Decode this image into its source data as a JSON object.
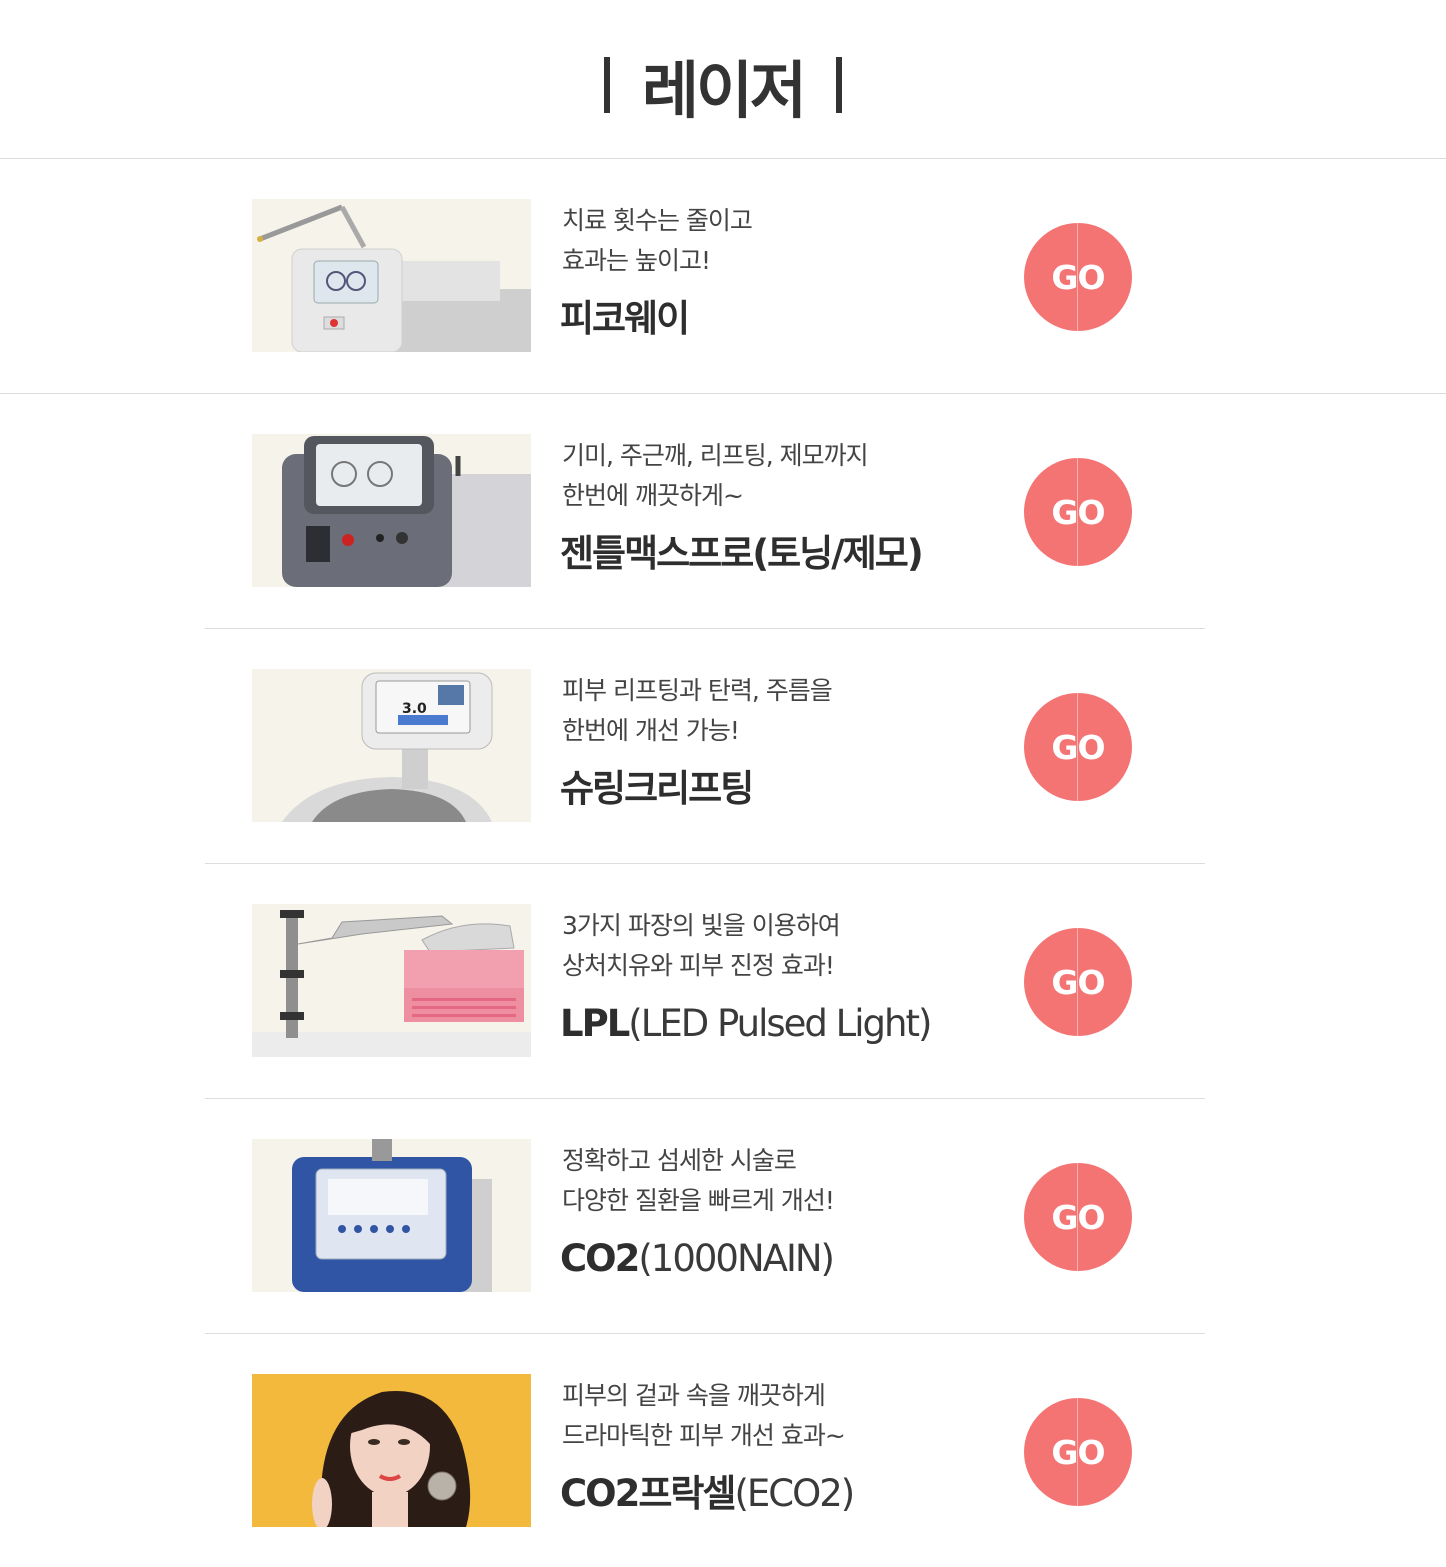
{
  "page": {
    "title": "레이저",
    "accent_color": "#f47474"
  },
  "items": [
    {
      "desc_line1": "치료 횟수는 줄이고",
      "desc_line2": "효과는 높이고!",
      "name_bold": "피코웨이",
      "name_light": "",
      "button_label": "GO",
      "image": "picoway-laser-device"
    },
    {
      "desc_line1": "기미, 주근깨, 리프팅, 제모까지",
      "desc_line2": "한번에 깨끗하게~",
      "name_bold": "젠틀맥스프로(토닝/제모)",
      "name_light": "",
      "button_label": "GO",
      "image": "gentlemax-pro-device"
    },
    {
      "desc_line1": "피부 리프팅과 탄력, 주름을",
      "desc_line2": "한번에 개선 가능!",
      "name_bold": "슈링크리프팅",
      "name_light": "",
      "button_label": "GO",
      "image": "shurink-lifting-device"
    },
    {
      "desc_line1": "3가지 파장의 빛을 이용하여",
      "desc_line2": "상처치유와 피부 진정 효과!",
      "name_bold": "LPL",
      "name_light": "(LED Pulsed Light)",
      "button_label": "GO",
      "image": "lpl-led-device"
    },
    {
      "desc_line1": "정확하고 섬세한 시술로",
      "desc_line2": "다양한 질환을 빠르게 개선!",
      "name_bold": "CO2",
      "name_light": "(1000NAIN)",
      "button_label": "GO",
      "image": "co2-laser-device"
    },
    {
      "desc_line1": "피부의 겉과 속을 깨끗하게",
      "desc_line2": "드라마틱한 피부 개선 효과~",
      "name_bold": "CO2프락셀",
      "name_light": "(ECO2)",
      "button_label": "GO",
      "image": "model-portrait"
    }
  ]
}
